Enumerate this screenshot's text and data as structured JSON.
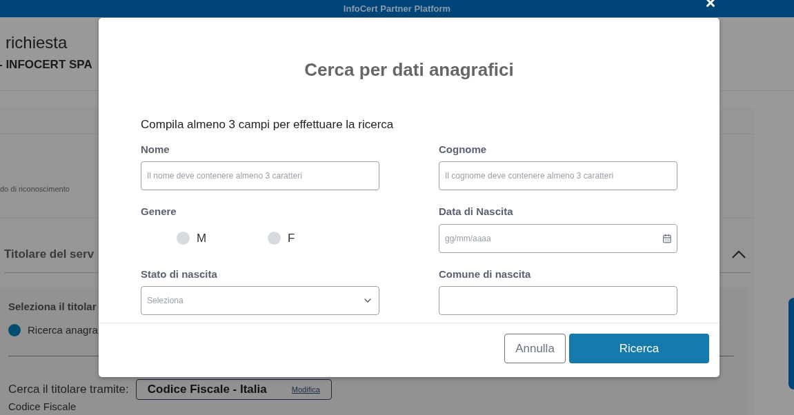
{
  "header": {
    "title": "InfoCert Partner Platform"
  },
  "page": {
    "title": "richiesta",
    "subtitle": "- INFOCERT SPA",
    "note": "do di riconoscimento",
    "section_title": "Titolare del serv",
    "select_label": "Seleziona il titolar",
    "radio": {
      "label": "Ricerca anagra",
      "selected": true
    },
    "search_via_label": "Cerca il titolare tramite:",
    "search_via_value": "Codice Fiscale - Italia",
    "search_via_link": "Modifica",
    "field_label": "Codice Fiscale"
  },
  "modal": {
    "title": "Cerca per dati anagrafici",
    "instruction": "Compila almeno 3 campi per effettuare la ricerca",
    "fields": [
      {
        "kind": "text",
        "label": "Nome",
        "placeholder": "Il nome deve contenere almeno 3 caratteri"
      },
      {
        "kind": "text",
        "label": "Cognome",
        "placeholder": "Il cognome deve contenere almeno 3 caratteri"
      },
      {
        "kind": "radio",
        "label": "Genere",
        "options": [
          {
            "label": "M",
            "selected": false
          },
          {
            "label": "F",
            "selected": false
          }
        ]
      },
      {
        "kind": "date",
        "label": "Data di Nascita",
        "placeholder": "gg/mm/aaaa"
      },
      {
        "kind": "select",
        "label": "Stato di nascita",
        "placeholder": "Seleziona"
      },
      {
        "kind": "text",
        "label": "Comune di nascita"
      }
    ],
    "buttons": [
      {
        "kind": "secondary",
        "label": "Annulla"
      },
      {
        "kind": "primary",
        "label": "Ricerca"
      }
    ]
  }
}
